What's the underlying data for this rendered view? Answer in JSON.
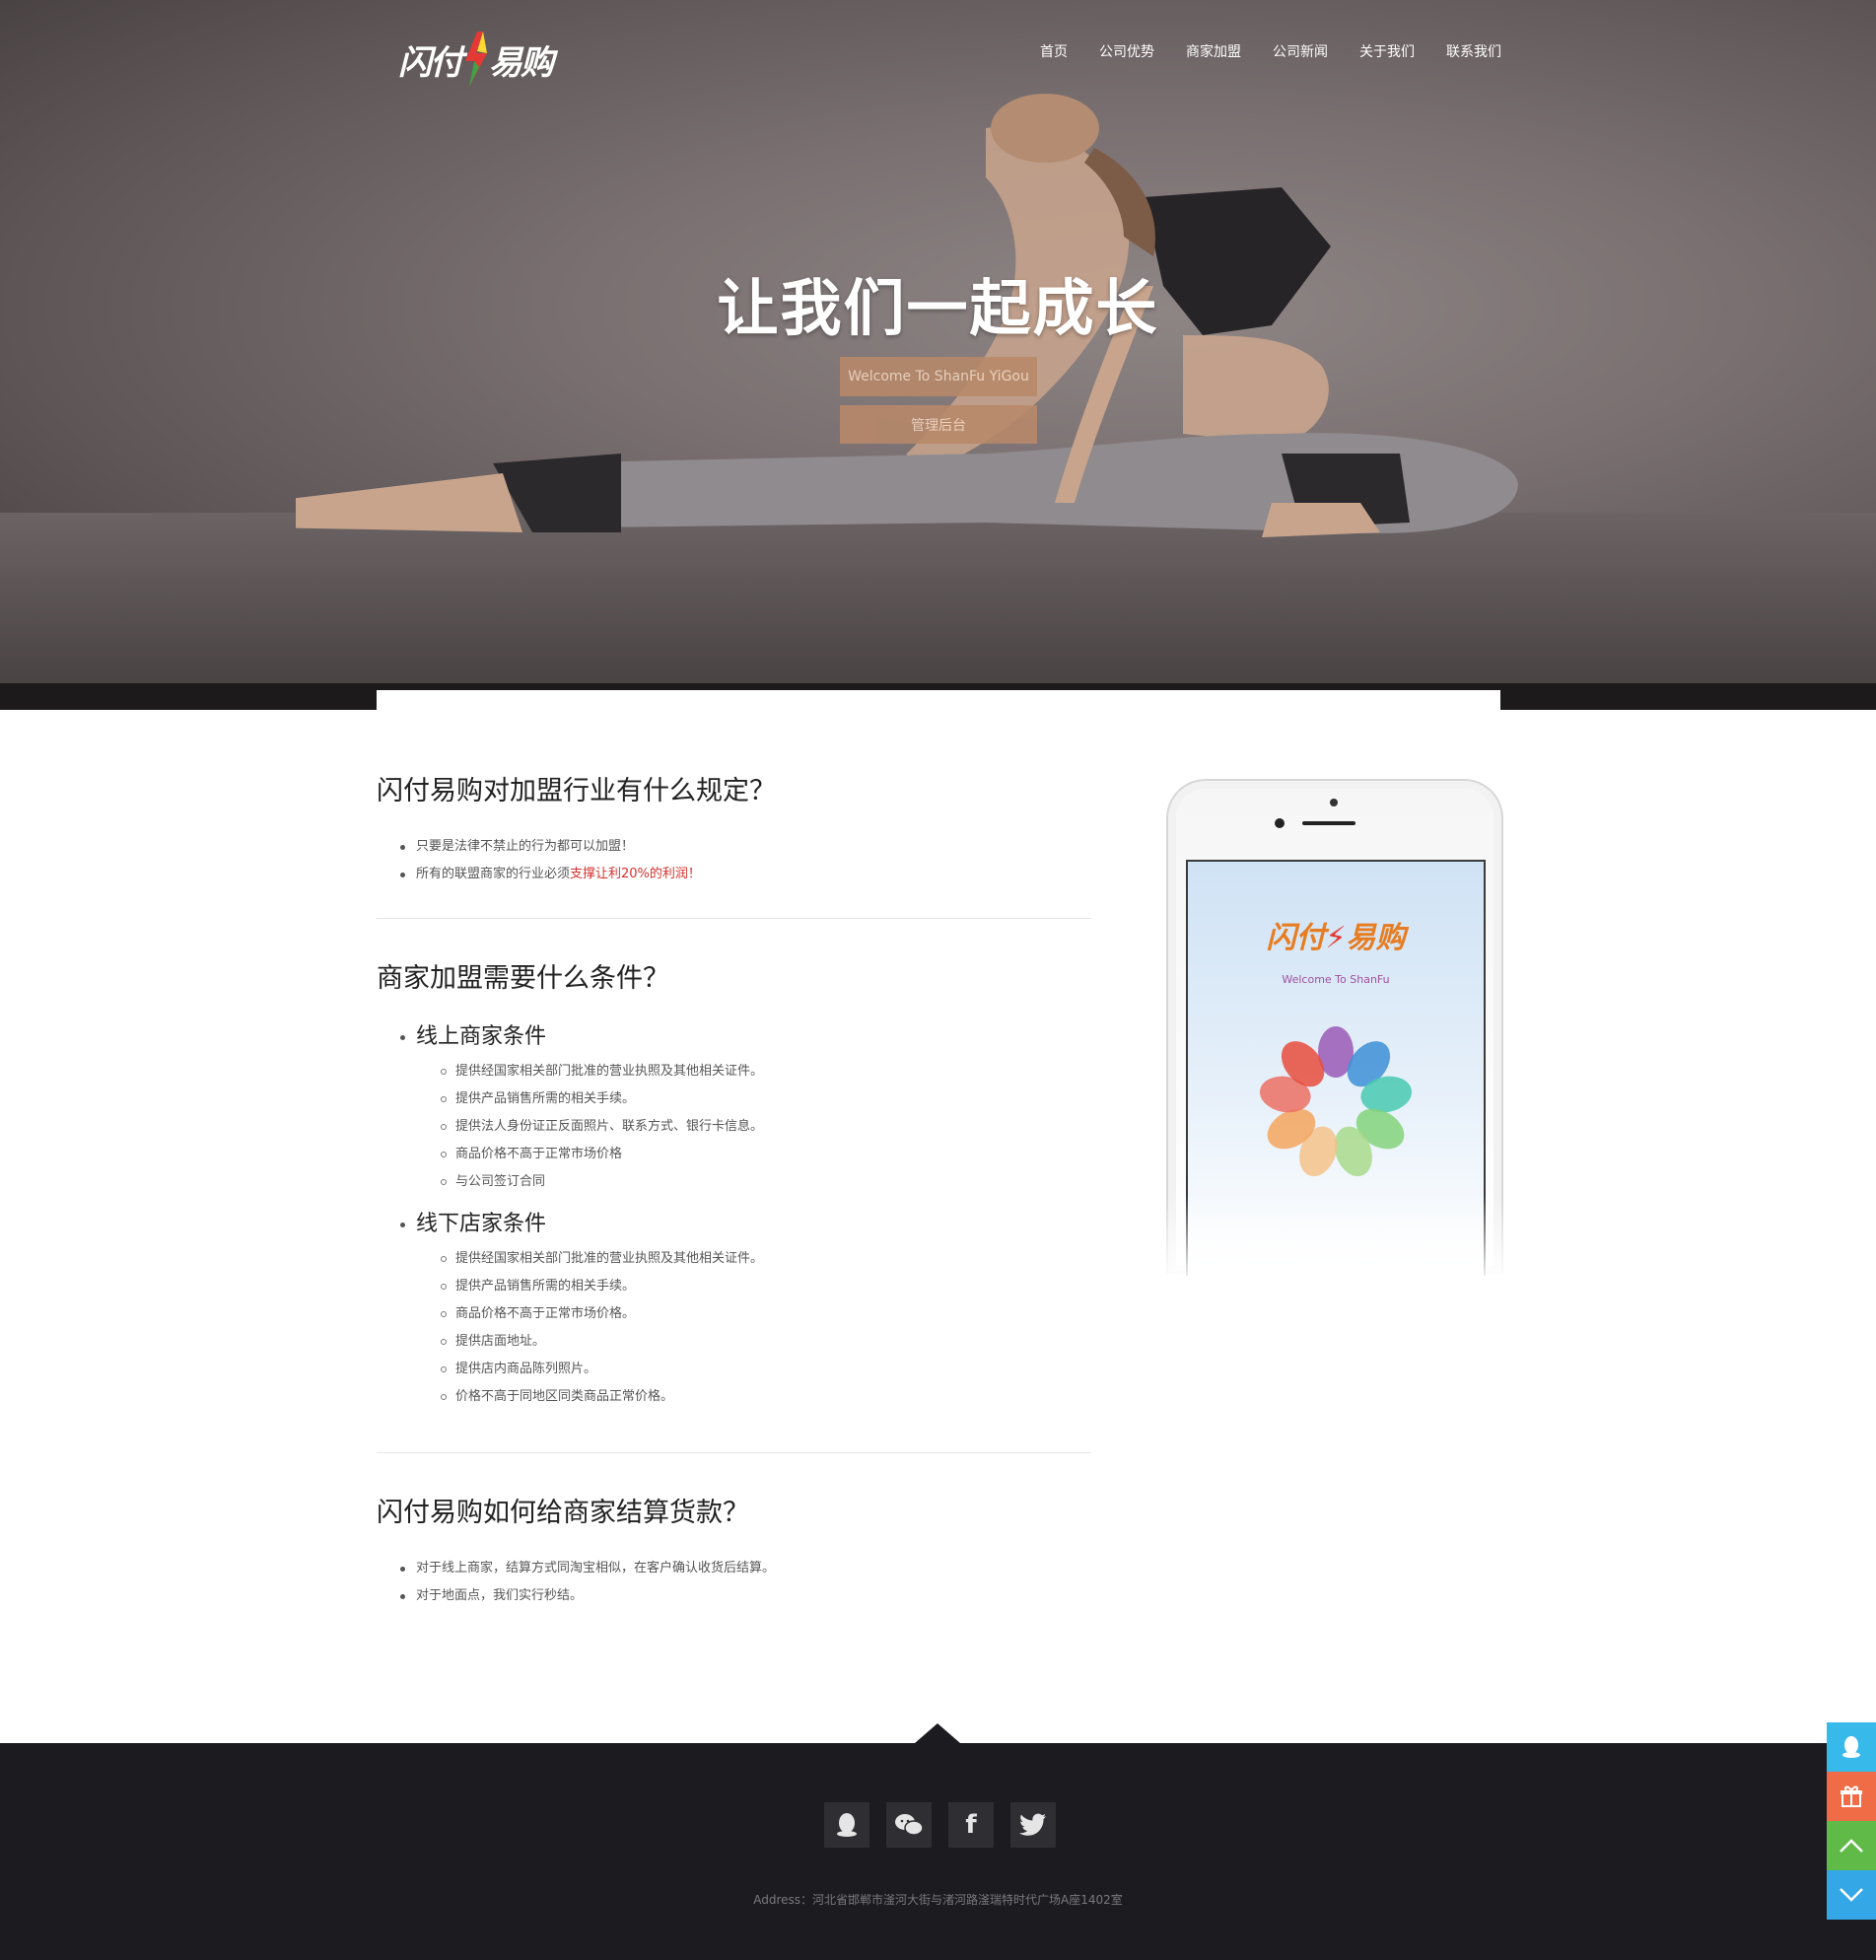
{
  "header": {
    "logo_left": "闪付",
    "logo_right": "易购",
    "nav": [
      "首页",
      "公司优势",
      "商家加盟",
      "公司新闻",
      "关于我们",
      "联系我们"
    ]
  },
  "hero": {
    "title": "让我们一起成长",
    "welcome_button": "Welcome To ShanFu YiGou",
    "admin_button": "管理后台"
  },
  "sections": [
    {
      "title": "闪付易购对加盟行业有什么规定？",
      "items": [
        "只要是法律不禁止的行为都可以加盟！",
        "所有的联盟商家的行业必须"
      ],
      "highlight": "支撑让利20%的利润！"
    },
    {
      "title": "商家加盟需要什么条件？",
      "online_title": "线上商家条件",
      "online_items": [
        "提供经国家相关部门批准的营业执照及其他相关证件。",
        "提供产品销售所需的相关手续。",
        "提供法人身份证正反面照片、联系方式、银行卡信息。",
        "商品价格不高于正常市场价格",
        "与公司签订合同"
      ],
      "offline_title": "线下店家条件",
      "offline_items": [
        "提供经国家相关部门批准的营业执照及其他相关证件。",
        "提供产品销售所需的相关手续。",
        "商品价格不高于正常市场价格。",
        "提供店面地址。",
        "提供店内商品陈列照片。",
        "价格不高于同地区同类商品正常价格。"
      ]
    },
    {
      "title": "闪付易购如何给商家结算货款？",
      "items": [
        "对于线上商家，结算方式同淘宝相似，在客户确认收货后结算。",
        "对于地面点，我们实行秒结。"
      ]
    }
  ],
  "phone": {
    "logo_left": "闪付",
    "logo_right": "易购",
    "subtitle": "Welcome To ShanFu"
  },
  "footer": {
    "social_icons": [
      "qq-icon",
      "wechat-icon",
      "facebook-icon",
      "twitter-icon"
    ],
    "address": "Address：河北省邯郸市滏河大街与渚河路滏瑞特时代广场A座1402室"
  },
  "float_bar": [
    "qq-icon",
    "gift-icon",
    "arrow-up-icon",
    "arrow-down-icon"
  ],
  "colors": {
    "accent_button": "#b8896a",
    "highlight_red": "#d7312c",
    "footer_bg": "#1c1b20",
    "float_qq": "#37b9ea",
    "float_gift": "#ef6c46",
    "float_up": "#5fba47",
    "float_down": "#34a7e6"
  }
}
